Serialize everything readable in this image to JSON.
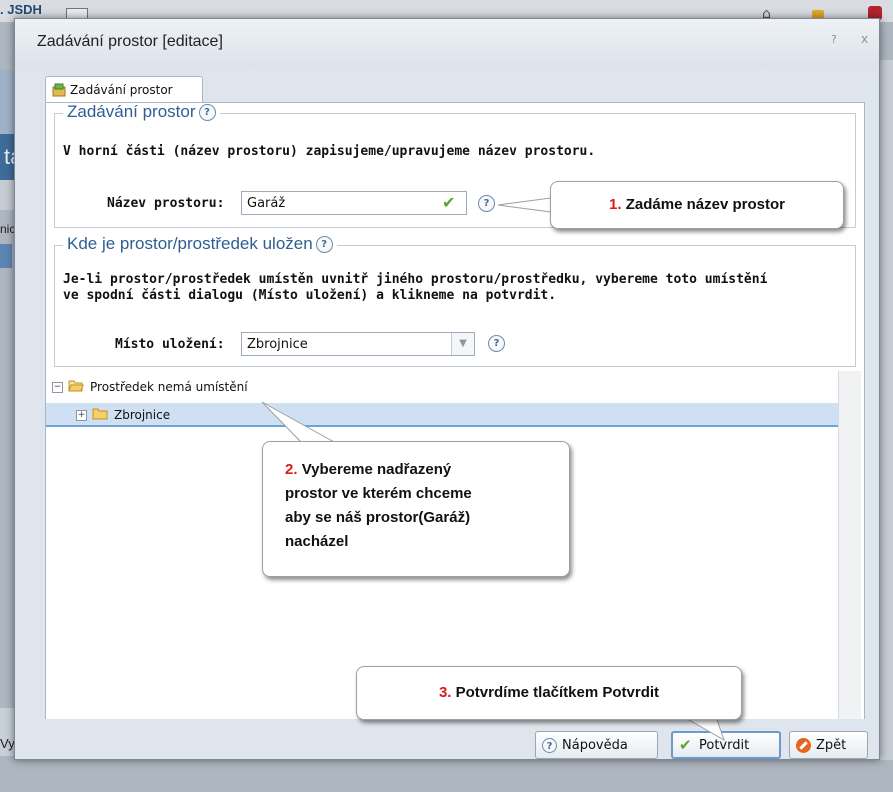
{
  "background": {
    "brand": ". JSDH",
    "panel_label": "ta",
    "list_item": "nice",
    "button_partial": "Vyt"
  },
  "dialog": {
    "title": "Zadávání prostor [editace]",
    "help_glyph": "?",
    "close_glyph": "x",
    "tab_label": "Zadávání prostor"
  },
  "section1": {
    "legend": "Zadávání prostor",
    "description": "V horní části (název prostoru) zapisujeme/upravujeme název prostoru.",
    "name_label": "Název prostoru:",
    "name_value": "Garáž"
  },
  "section2": {
    "legend": "Kde je prostor/prostředek uložen",
    "description_line1": "Je-li prostor/prostředek umístěn uvnitř jiného prostoru/prostředku, vybereme toto umístění",
    "description_line2": "ve spodní části dialogu (Místo uložení) a klikneme na potvrdit.",
    "location_label": "Místo uložení:",
    "location_value": "Zbrojnice",
    "tree": [
      {
        "label": "Prostředek nemá umístění",
        "toggle": "−",
        "selected": false
      },
      {
        "label": "Zbrojnice",
        "toggle": "+",
        "selected": true
      }
    ]
  },
  "buttons": {
    "help": "Nápověda",
    "confirm": "Potvrdit",
    "back": "Zpět"
  },
  "callouts": [
    {
      "number": "1.",
      "text": "Zadáme název prostor"
    },
    {
      "number": "2.",
      "line1": "Vybereme nadřazený",
      "line2": "prostor ve kterém chceme",
      "line3": "aby se náš prostor(Garáž)",
      "line4": "nacházel"
    },
    {
      "number": "3.",
      "text": "Potvrdíme tlačítkem Potvrdit"
    }
  ],
  "colors": {
    "accent_blue": "#2e5e92",
    "callout_number": "#e01818",
    "confirm_green": "#5aa42b",
    "selection": "#cfe0f3"
  }
}
